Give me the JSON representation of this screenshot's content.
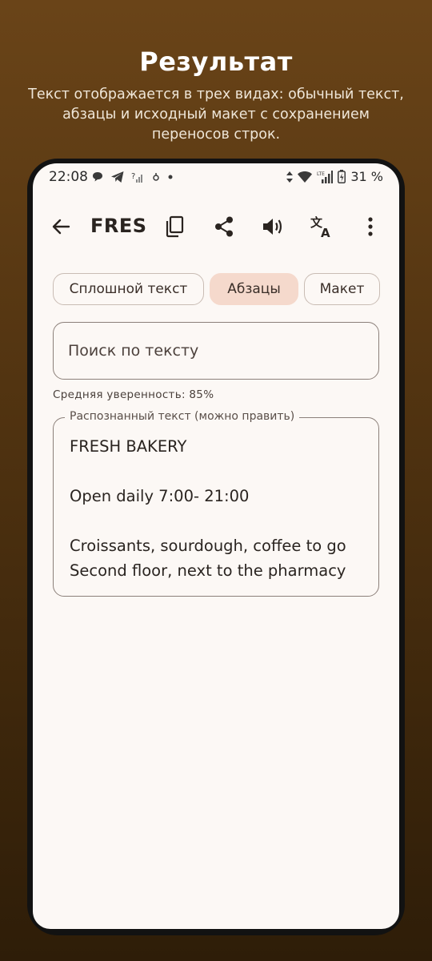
{
  "promo": {
    "title": "Результат",
    "subtitle": "Текст отображается в трех видах: обычный текст, абзацы и исходный макет с сохранением переносов строк."
  },
  "status_bar": {
    "time": "22:08",
    "battery": "31 %",
    "left_icons": [
      "message-icon",
      "telegram-icon",
      "no-signal-icon",
      "notification-icon",
      "dot-icon"
    ],
    "right_icons": [
      "data-arrows-icon",
      "wifi-icon",
      "lte-signal-icon",
      "battery-icon"
    ]
  },
  "app_bar": {
    "title": "FRES",
    "actions": [
      "copy-icon",
      "share-icon",
      "volume-icon",
      "translate-icon",
      "more-vert-icon"
    ]
  },
  "tabs": [
    {
      "label": "Сплошной текст",
      "selected": false
    },
    {
      "label": "Абзацы",
      "selected": true
    },
    {
      "label": "Макет",
      "selected": false
    }
  ],
  "search": {
    "placeholder": "Поиск по тексту"
  },
  "confidence_label": "Средняя уверенность: 85%",
  "recognized": {
    "legend": "Распознанный текст (можно править)",
    "text": "FRESH BAKERY\n\nOpen daily 7:00- 21:00\n\nCroissants, sourdough, coffee to go\nSecond floor, next to the pharmacy"
  },
  "colors": {
    "background_top": "#6a4418",
    "background_bottom": "#2e1d08",
    "screen": "#fcf8f5",
    "chip_selected": "#f5d9cc",
    "outline": "#8c807a"
  }
}
